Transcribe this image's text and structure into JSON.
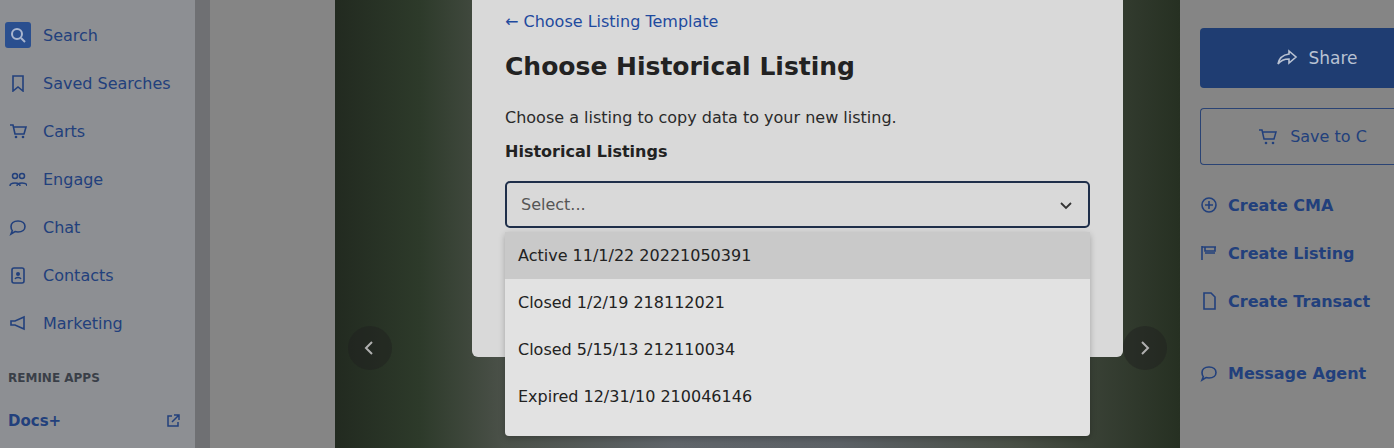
{
  "sidebar": {
    "items": [
      {
        "label": "Search",
        "selected": true
      },
      {
        "label": "Saved Searches",
        "selected": false
      },
      {
        "label": "Carts",
        "selected": false
      },
      {
        "label": "Engage",
        "selected": false
      },
      {
        "label": "Chat",
        "selected": false
      },
      {
        "label": "Contacts",
        "selected": false
      },
      {
        "label": "Marketing",
        "selected": false
      }
    ],
    "section": "REMINE APPS",
    "apps": [
      {
        "label": "Docs+"
      }
    ]
  },
  "actions": {
    "share": "Share",
    "save": "Save to C",
    "links": [
      "Create CMA",
      "Create Listing",
      "Create Transact",
      "Message Agent"
    ]
  },
  "modal": {
    "back": "← Choose Listing Template",
    "title": "Choose Historical Listing",
    "description": "Choose a listing to copy data to your new listing.",
    "field_label": "Historical Listings",
    "select": {
      "placeholder": "Select...",
      "expanded": true
    },
    "options": [
      {
        "label": "Active 11/1/22 20221050391",
        "highlighted": true
      },
      {
        "label": "Closed 1/2/19 218112021",
        "highlighted": false
      },
      {
        "label": "Closed 5/15/13 212110034",
        "highlighted": false
      },
      {
        "label": "Expired 12/31/10 210046146",
        "highlighted": false
      }
    ]
  }
}
